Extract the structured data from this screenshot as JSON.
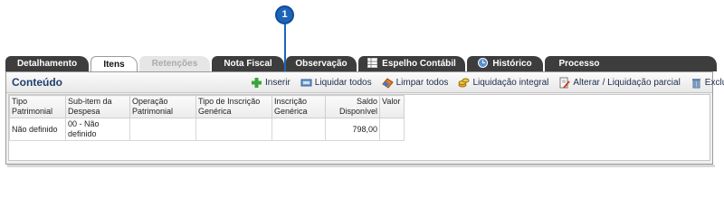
{
  "callout": {
    "number": "1"
  },
  "tabs": [
    {
      "label": "Detalhamento",
      "state": "normal"
    },
    {
      "label": "Itens",
      "state": "active"
    },
    {
      "label": "Retenções",
      "state": "disabled"
    },
    {
      "label": "Nota Fiscal",
      "state": "normal"
    },
    {
      "label": "Observação",
      "state": "normal"
    },
    {
      "label": "Espelho Contábil",
      "state": "normal",
      "icon": "table-icon"
    },
    {
      "label": "Histórico",
      "state": "normal",
      "icon": "history-icon"
    },
    {
      "label": "Processo",
      "state": "normal"
    }
  ],
  "panel": {
    "title": "Conteúdo",
    "toolbar": [
      {
        "label": "Inserir",
        "icon": "plus-icon"
      },
      {
        "label": "Liquidar todos",
        "icon": "settle-all-icon"
      },
      {
        "label": "Limpar todos",
        "icon": "eraser-icon"
      },
      {
        "label": "Liquidação integral",
        "icon": "coins-icon"
      },
      {
        "label": "Alterar / Liquidação parcial",
        "icon": "edit-document-icon"
      },
      {
        "label": "Excluir",
        "icon": "trash-icon"
      }
    ]
  },
  "table": {
    "columns": [
      "Tipo Patrimonial",
      "Sub-item da Despesa",
      "Operação Patrimonial",
      "Tipo de Inscrição Genérica",
      "Inscrição Genérica",
      "Saldo Disponível",
      "Valor"
    ],
    "rows": [
      [
        "Não definido",
        "00 - Não definido",
        "",
        "",
        "",
        "798,00",
        ""
      ]
    ]
  },
  "colors": {
    "tab_dark": "#3d3d3d",
    "title_blue": "#1e3f6e",
    "callout_blue": "#1d64b8"
  }
}
